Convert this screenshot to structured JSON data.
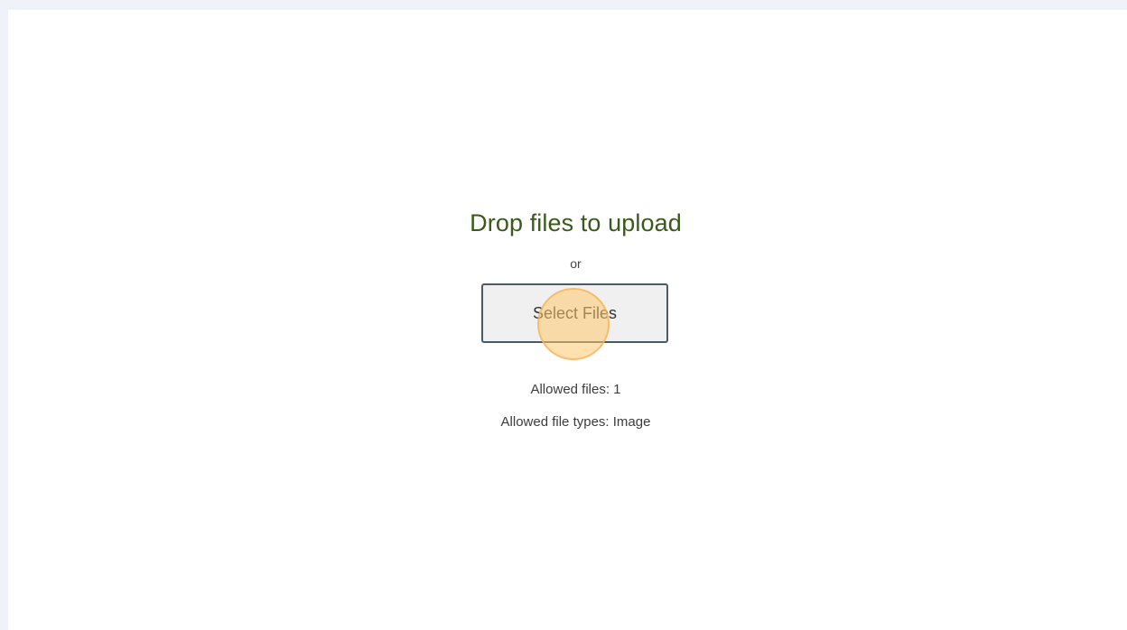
{
  "upload": {
    "title": "Drop files to upload",
    "separator": "or",
    "button_label": "Select Files",
    "allowed_files": "Allowed files: 1",
    "allowed_types": "Allowed file types: Image"
  },
  "colors": {
    "page_background": "#f0f2f9",
    "panel_background": "#ffffff",
    "title_color": "#3a5a1c",
    "click_marker": "#ffc86e"
  }
}
